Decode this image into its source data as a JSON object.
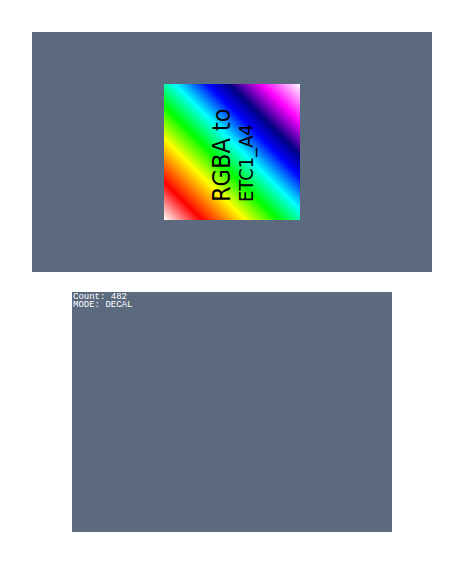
{
  "top_screen": {
    "texture": {
      "lines": [
        "RGBA to",
        "ETC1_A4"
      ]
    }
  },
  "bottom_screen": {
    "lines": [
      "Count: 482",
      "MODE: DECAL"
    ]
  }
}
